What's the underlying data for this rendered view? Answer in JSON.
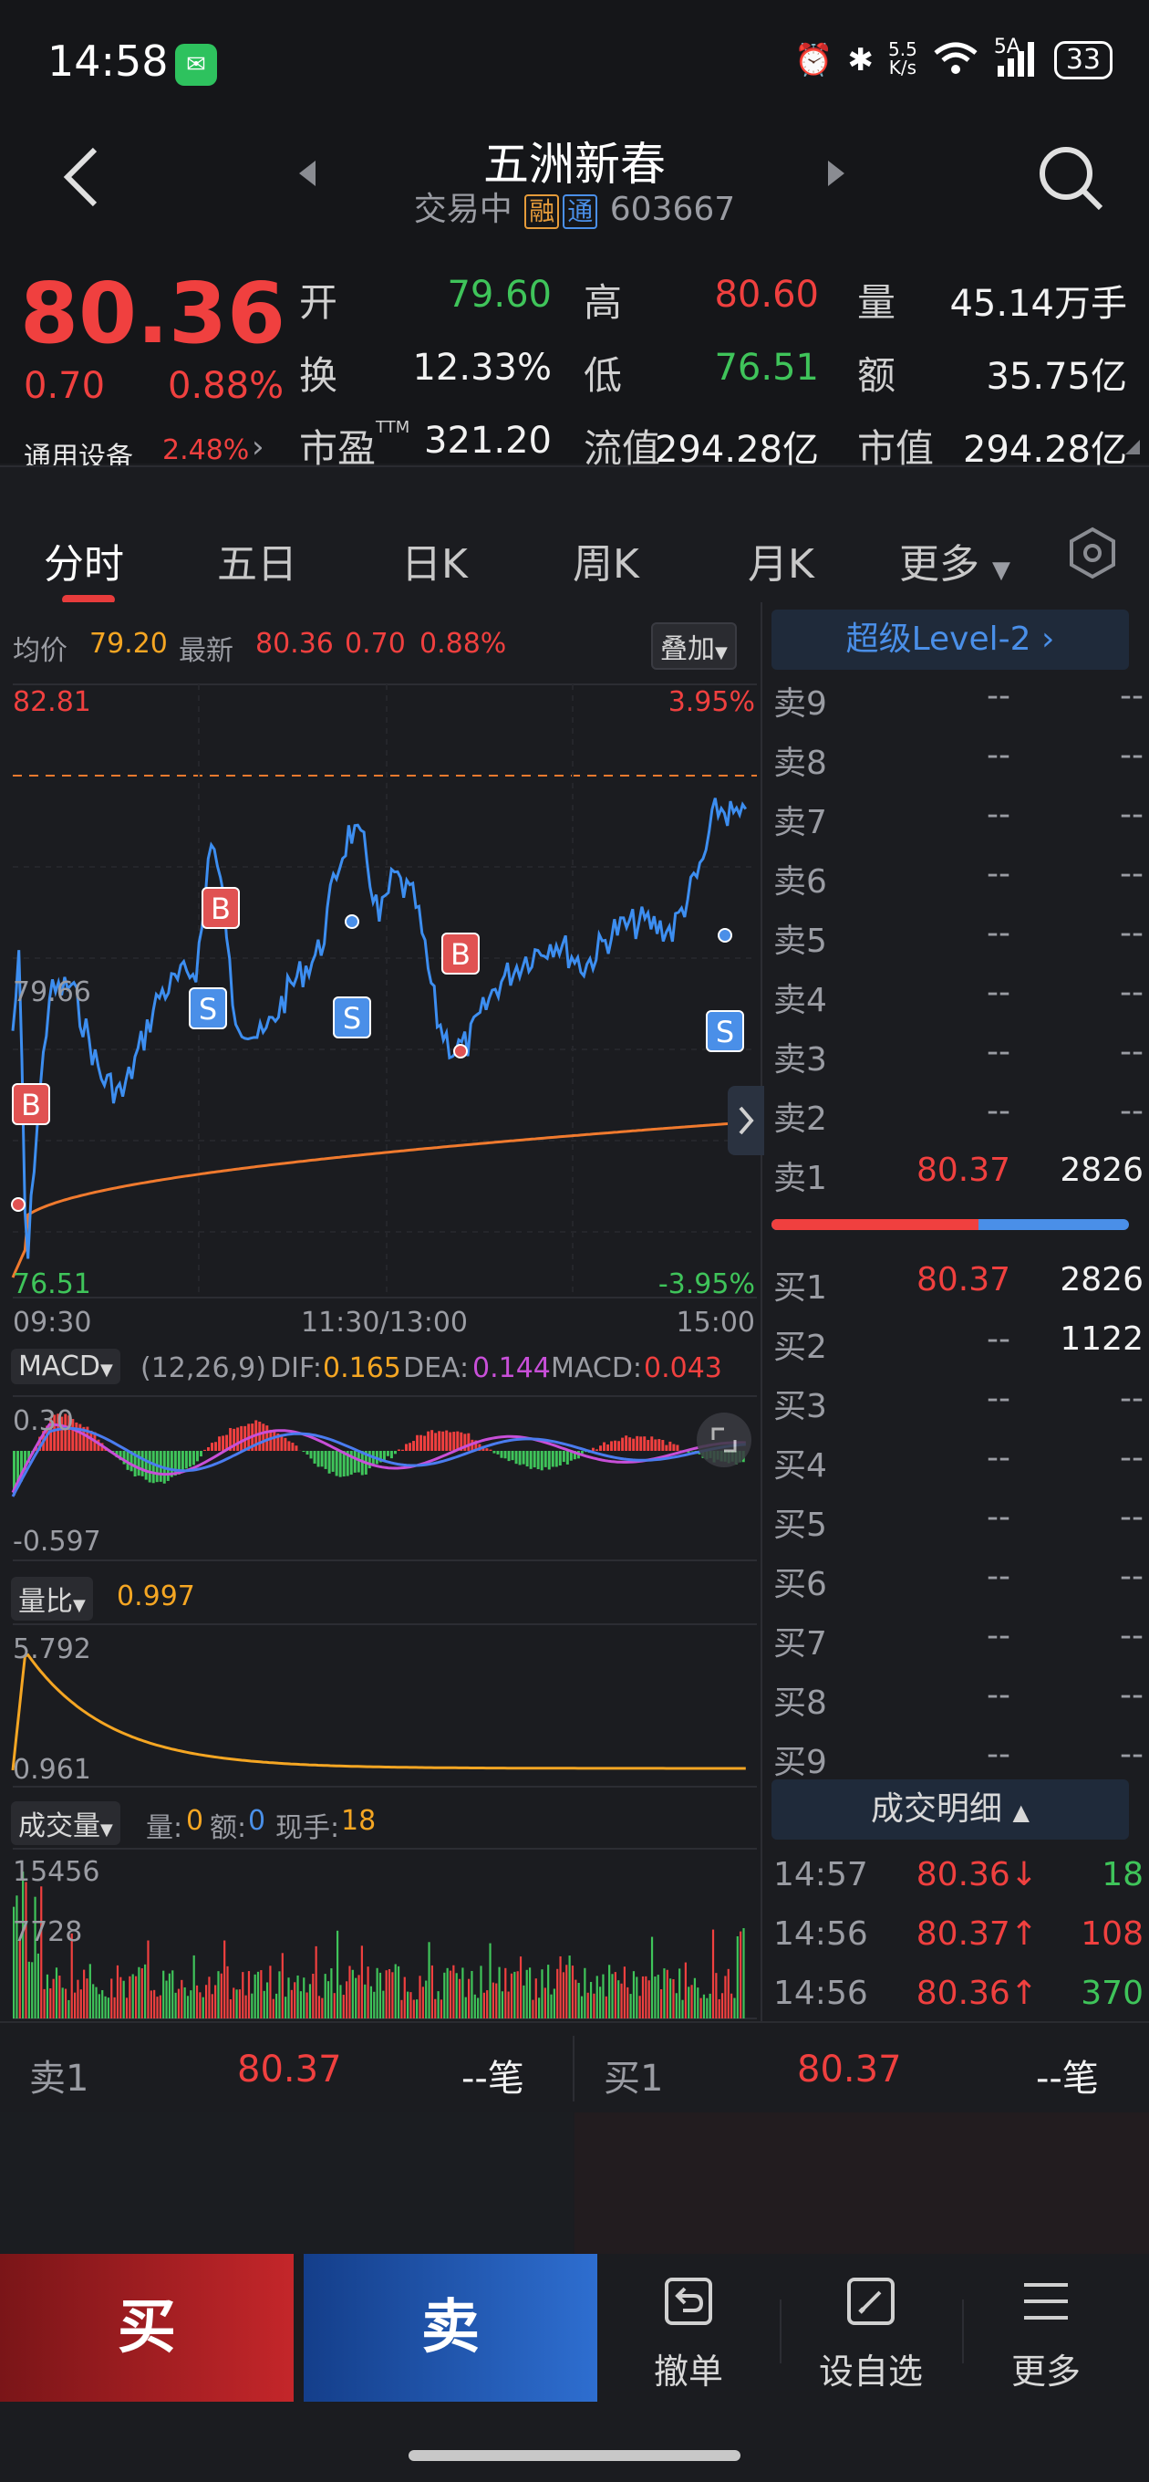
{
  "status_bar": {
    "time": "14:58",
    "app_icon": "wechat-icon",
    "net_speed_top": "5.5",
    "net_speed_bottom": "K/s",
    "signal_label": "5A",
    "battery": "33"
  },
  "header": {
    "title": "五洲新春",
    "status": "交易中",
    "tag_rong": "融",
    "tag_tong": "通",
    "code": "603667"
  },
  "quote": {
    "price": "80.36",
    "change": "0.70",
    "change_pct": "0.88%",
    "industry": "通用设备",
    "industry_pct": "2.48%",
    "fields": [
      {
        "label": "开",
        "value": "79.60",
        "color": "#3fc45a"
      },
      {
        "label": "高",
        "value": "80.60",
        "color": "#f0403f"
      },
      {
        "label": "量",
        "value": "45.14万手",
        "color": "#f2f2f2"
      },
      {
        "label": "换",
        "value": "12.33%",
        "color": "#f2f2f2"
      },
      {
        "label": "低",
        "value": "76.51",
        "color": "#3fc45a"
      },
      {
        "label": "额",
        "value": "35.75亿",
        "color": "#f2f2f2"
      },
      {
        "label": "市盈TTM",
        "value": "321.20",
        "color": "#f2f2f2"
      },
      {
        "label": "流值",
        "value": "294.28亿",
        "color": "#f2f2f2"
      },
      {
        "label": "市值",
        "value": "294.28亿",
        "color": "#f2f2f2"
      }
    ]
  },
  "tabs": [
    "分时",
    "五日",
    "日K",
    "周K",
    "月K",
    "更多"
  ],
  "intraday": {
    "avg_label": "均价",
    "avg_value": "79.20",
    "latest_label": "最新",
    "latest_value": "80.36",
    "latest_change": "0.70",
    "latest_pct": "0.88%",
    "overlay_label": "叠加",
    "y_top": "82.81",
    "y_top_pct": "3.95%",
    "y_mid": "79.66",
    "y_bottom": "76.51",
    "y_bottom_pct": "-3.95%",
    "x_labels": [
      "09:30",
      "11:30/13:00",
      "15:00"
    ],
    "markers": [
      "B",
      "B",
      "B",
      "S",
      "S",
      "S"
    ]
  },
  "macd": {
    "label": "MACD",
    "params": "(12,26,9)",
    "dif_label": "DIF:",
    "dif": "0.165",
    "dea_label": "DEA:",
    "dea": "0.144",
    "macd_label": "MACD:",
    "macd": "0.043",
    "y_top": "0.30",
    "y_bottom": "-0.597"
  },
  "volume_ratio": {
    "label": "量比",
    "value": "0.997",
    "y_top": "5.792",
    "y_bottom": "0.961"
  },
  "volume": {
    "label": "成交量",
    "qty_label": "量:",
    "qty": "0",
    "amt_label": "额:",
    "amt": "0",
    "hand_label": "现手:",
    "hand": "18",
    "y_top": "15456",
    "y_mid": "7728"
  },
  "order_book": {
    "level2_label": "超级Level-2",
    "asks": [
      {
        "label": "卖9",
        "price": "--",
        "vol": "--"
      },
      {
        "label": "卖8",
        "price": "--",
        "vol": "--"
      },
      {
        "label": "卖7",
        "price": "--",
        "vol": "--"
      },
      {
        "label": "卖6",
        "price": "--",
        "vol": "--"
      },
      {
        "label": "卖5",
        "price": "--",
        "vol": "--"
      },
      {
        "label": "卖4",
        "price": "--",
        "vol": "--"
      },
      {
        "label": "卖3",
        "price": "--",
        "vol": "--"
      },
      {
        "label": "卖2",
        "price": "--",
        "vol": "--"
      },
      {
        "label": "卖1",
        "price": "80.37",
        "vol": "2826"
      }
    ],
    "bids": [
      {
        "label": "买1",
        "price": "80.37",
        "vol": "2826"
      },
      {
        "label": "买2",
        "price": "--",
        "vol": "1122"
      },
      {
        "label": "买3",
        "price": "--",
        "vol": "--"
      },
      {
        "label": "买4",
        "price": "--",
        "vol": "--"
      },
      {
        "label": "买5",
        "price": "--",
        "vol": "--"
      },
      {
        "label": "买6",
        "price": "--",
        "vol": "--"
      },
      {
        "label": "买7",
        "price": "--",
        "vol": "--"
      },
      {
        "label": "买8",
        "price": "--",
        "vol": "--"
      },
      {
        "label": "买9",
        "price": "--",
        "vol": "--"
      }
    ],
    "balance_ask_fraction": 0.58,
    "trades_label": "成交明细",
    "trades": [
      {
        "time": "14:57",
        "price": "80.36↓",
        "vol": "18",
        "vol_color": "#3fc45a"
      },
      {
        "time": "14:56",
        "price": "80.37↑",
        "vol": "108",
        "vol_color": "#f0403f"
      },
      {
        "time": "14:56",
        "price": "80.36↑",
        "vol": "370",
        "vol_color": "#3fc45a"
      }
    ]
  },
  "bottom_quote": {
    "sell_label": "卖1",
    "sell_price": "80.37",
    "sell_count": "--笔",
    "buy_label": "买1",
    "buy_price": "80.37",
    "buy_count": "--笔"
  },
  "actions": {
    "buy": "买",
    "sell": "卖",
    "cancel": "撤单",
    "watchlist": "设自选",
    "more": "更多"
  }
}
